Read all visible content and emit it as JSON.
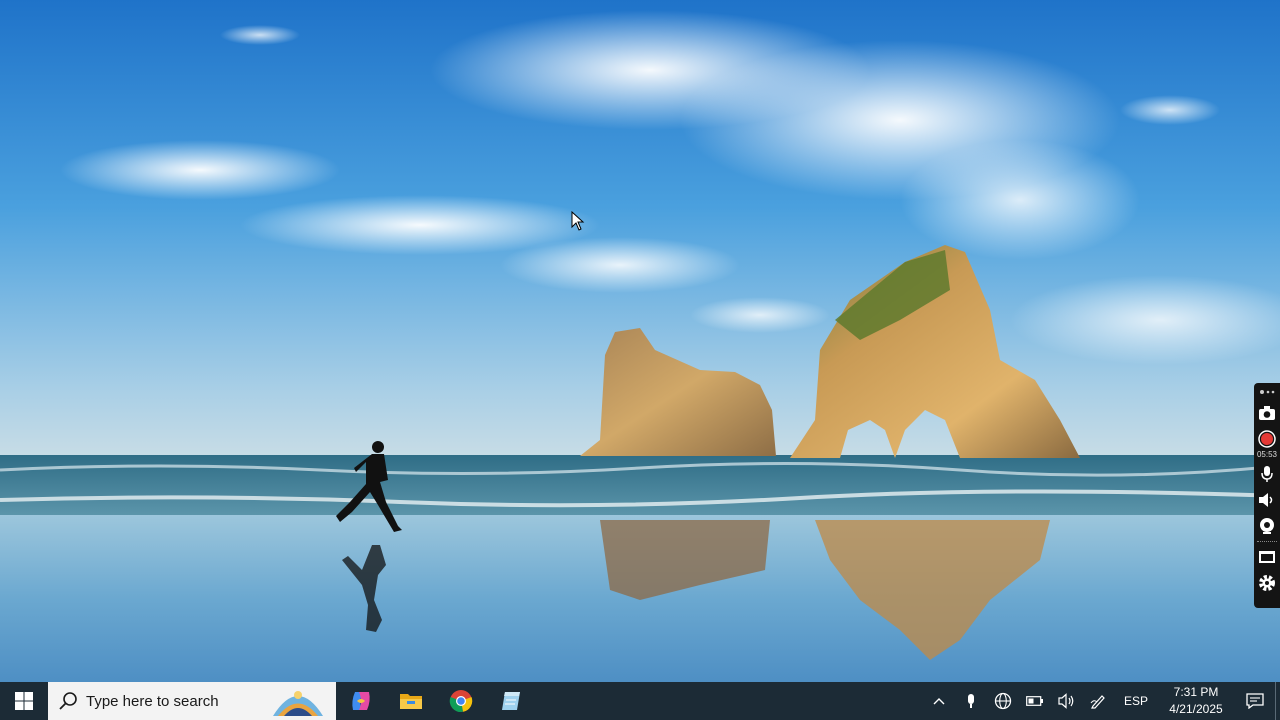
{
  "taskbar": {
    "search_placeholder": "Type here to search",
    "pinned": [
      {
        "name": "copilot-app",
        "icon": "copilot-icon"
      },
      {
        "name": "file-explorer-app",
        "icon": "folder-icon"
      },
      {
        "name": "chrome-app",
        "icon": "chrome-icon"
      },
      {
        "name": "notes-app",
        "icon": "notes-icon"
      }
    ],
    "tray": {
      "language": "ESP",
      "time": "7:31 PM",
      "date": "4/21/2025"
    }
  },
  "recorder": {
    "elapsed": "05:53",
    "record_color": "#e53935"
  },
  "colors": {
    "taskbar_bg": "#1c2b36",
    "search_bg": "#f3f3f3"
  }
}
